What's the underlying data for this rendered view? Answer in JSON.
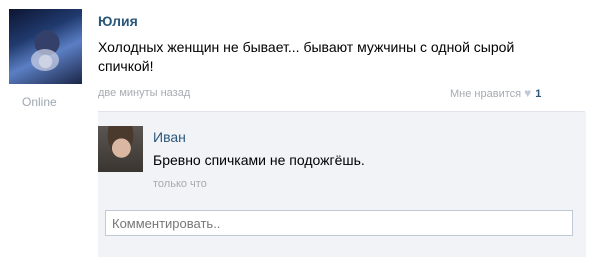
{
  "post": {
    "author": "Юлия",
    "status": "Online",
    "text": "Холодных женщин не бывает... бывают мужчины с одной сырой спичкой!",
    "date": "две минуты назад",
    "like_label": "Мне нравится",
    "like_count": "1"
  },
  "reply": {
    "author": "Иван",
    "text": "Бревно спичками не подожгёшь.",
    "date": "только что"
  },
  "comment": {
    "placeholder": "Комментировать.."
  }
}
